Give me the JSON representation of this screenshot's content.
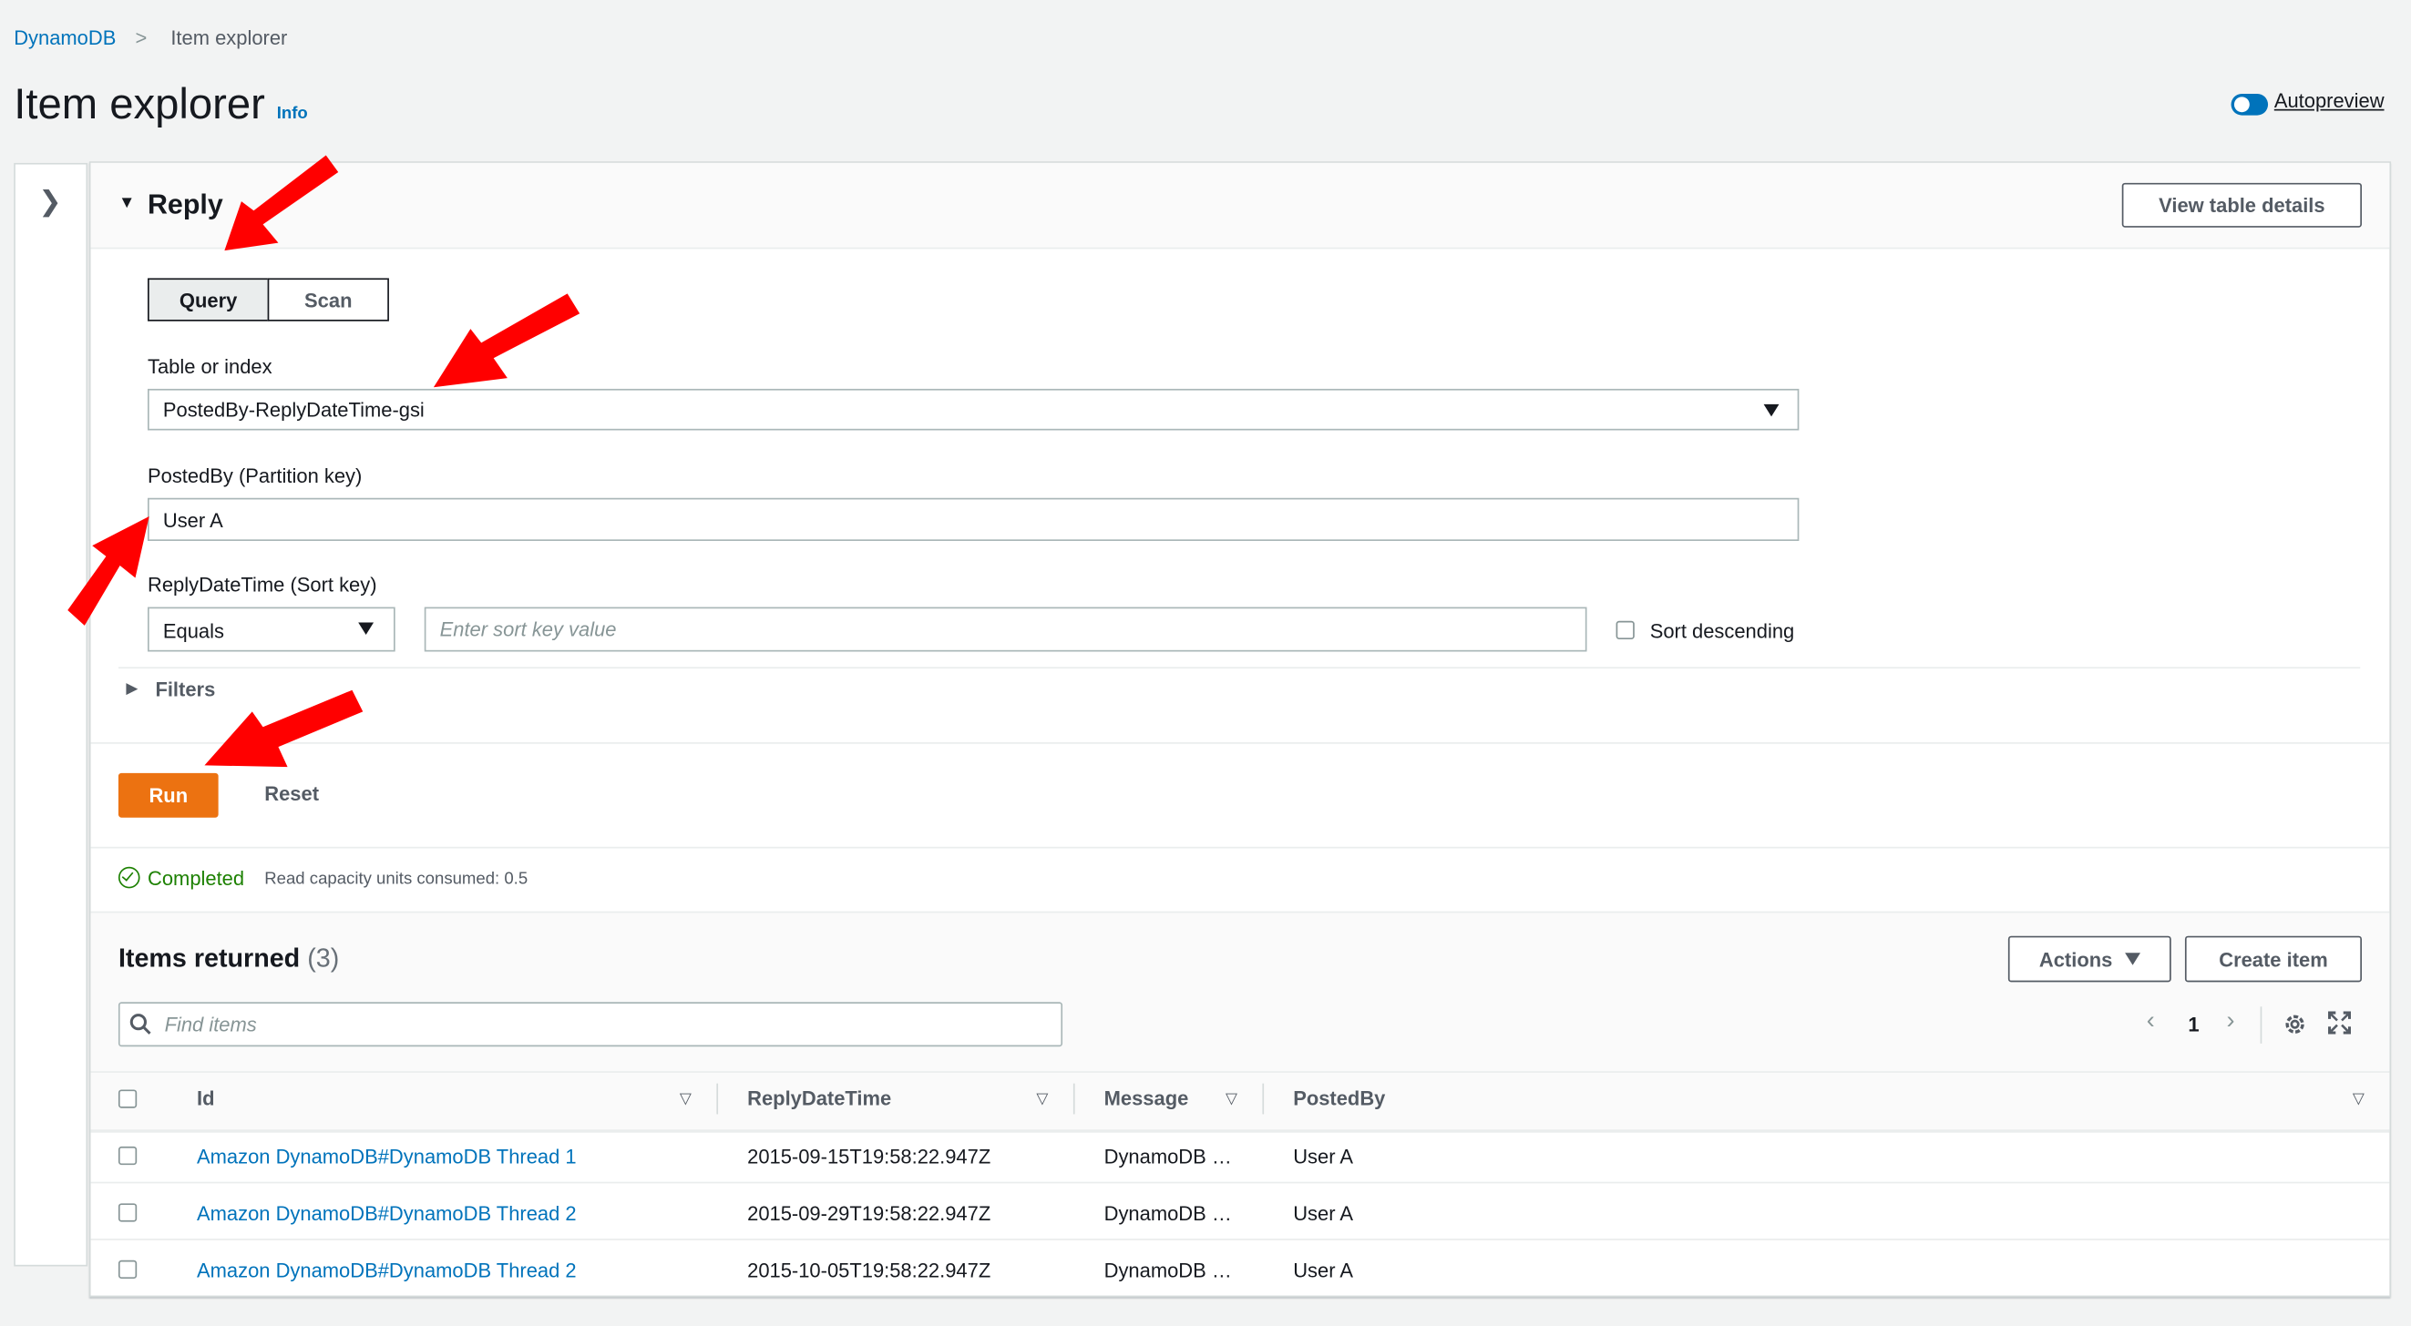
{
  "breadcrumb": {
    "root": "DynamoDB",
    "separator": ">",
    "current": "Item explorer"
  },
  "header": {
    "title": "Item explorer",
    "info": "Info",
    "autopreview_label": "Autopreview",
    "autopreview_on": true
  },
  "panel": {
    "table_name": "Reply",
    "view_details_label": "View table details"
  },
  "mode": {
    "query_label": "Query",
    "scan_label": "Scan",
    "selected": "Query"
  },
  "form": {
    "table_index_label": "Table or index",
    "table_index_value": "PostedBy-ReplyDateTime-gsi",
    "partition_label": "PostedBy (Partition key)",
    "partition_value": "User A",
    "sort_label": "ReplyDateTime (Sort key)",
    "sort_operator": "Equals",
    "sort_placeholder": "Enter sort key value",
    "sort_descending_label": "Sort descending",
    "filters_label": "Filters",
    "run_label": "Run",
    "reset_label": "Reset"
  },
  "status": {
    "text": "Completed",
    "detail": "Read capacity units consumed: 0.5"
  },
  "results": {
    "title": "Items returned",
    "count": "(3)",
    "actions_label": "Actions",
    "create_label": "Create item",
    "search_placeholder": "Find items",
    "page": "1",
    "columns": [
      "Id",
      "ReplyDateTime",
      "Message",
      "PostedBy"
    ],
    "rows": [
      {
        "id": "Amazon DynamoDB#DynamoDB Thread 1",
        "reply_date_time": "2015-09-15T19:58:22.947Z",
        "message": "DynamoDB …",
        "posted_by": "User A"
      },
      {
        "id": "Amazon DynamoDB#DynamoDB Thread 2",
        "reply_date_time": "2015-09-29T19:58:22.947Z",
        "message": "DynamoDB …",
        "posted_by": "User A"
      },
      {
        "id": "Amazon DynamoDB#DynamoDB Thread 2",
        "reply_date_time": "2015-10-05T19:58:22.947Z",
        "message": "DynamoDB …",
        "posted_by": "User A"
      }
    ]
  },
  "colors": {
    "link": "#0073bb",
    "primary_button": "#ec7211",
    "success": "#1d8102",
    "annotation_arrow": "#ff0000"
  }
}
